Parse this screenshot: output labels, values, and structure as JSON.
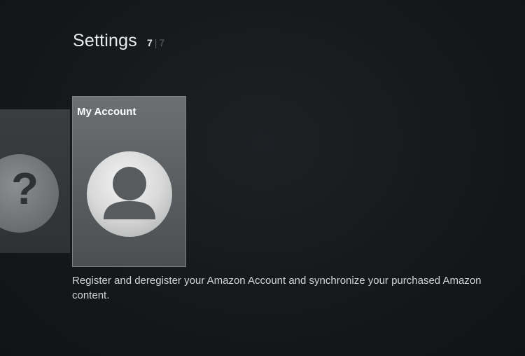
{
  "header": {
    "title": "Settings",
    "position_current": "7",
    "position_separator": "|",
    "position_total": "7"
  },
  "tiles": {
    "previous": {
      "icon": "help-icon",
      "glyph": "?"
    },
    "focused": {
      "label": "My Account",
      "icon": "user-avatar-icon"
    }
  },
  "description": "Register and deregister your Amazon Account and synchronize your purchased Amazon content."
}
